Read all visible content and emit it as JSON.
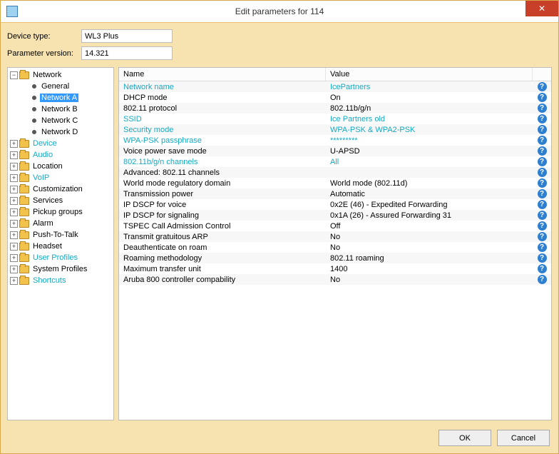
{
  "window": {
    "title": "Edit parameters for 114",
    "close_x": "✕"
  },
  "meta": {
    "device_type_label": "Device type:",
    "device_type_value": "WL3 Plus",
    "param_version_label": "Parameter version:",
    "param_version_value": "14.321"
  },
  "tree": {
    "root": {
      "label": "Network"
    },
    "children": [
      {
        "label": "General"
      },
      {
        "label": "Network A",
        "selected": true
      },
      {
        "label": "Network B"
      },
      {
        "label": "Network C"
      },
      {
        "label": "Network D"
      }
    ],
    "siblings": [
      {
        "label": "Device",
        "link": true
      },
      {
        "label": "Audio",
        "link": true
      },
      {
        "label": "Location"
      },
      {
        "label": "VoIP",
        "link": true
      },
      {
        "label": "Customization"
      },
      {
        "label": "Services"
      },
      {
        "label": "Pickup groups"
      },
      {
        "label": "Alarm"
      },
      {
        "label": "Push-To-Talk"
      },
      {
        "label": "Headset"
      },
      {
        "label": "User Profiles",
        "link": true
      },
      {
        "label": "System Profiles"
      },
      {
        "label": "Shortcuts",
        "link": true
      }
    ]
  },
  "grid": {
    "header_name": "Name",
    "header_value": "Value",
    "rows": [
      {
        "name": "Network name",
        "value": "IcePartners",
        "editable": true
      },
      {
        "name": "DHCP mode",
        "value": "On"
      },
      {
        "name": "802.11 protocol",
        "value": "802.11b/g/n"
      },
      {
        "name": "SSID",
        "value": "Ice Partners old",
        "editable": true
      },
      {
        "name": "Security mode",
        "value": "WPA-PSK & WPA2-PSK",
        "editable": true
      },
      {
        "name": "WPA-PSK passphrase",
        "value": "*********",
        "editable": true
      },
      {
        "name": "Voice power save mode",
        "value": "U-APSD"
      },
      {
        "name": "802.11b/g/n channels",
        "value": "All",
        "editable": true
      },
      {
        "name": "Advanced: 802.11 channels",
        "value": ""
      },
      {
        "name": "World mode regulatory domain",
        "value": "World mode (802.11d)"
      },
      {
        "name": "Transmission power",
        "value": "Automatic"
      },
      {
        "name": "IP DSCP for voice",
        "value": "0x2E (46) - Expedited Forwarding"
      },
      {
        "name": "IP DSCP for signaling",
        "value": "0x1A (26) - Assured Forwarding 31"
      },
      {
        "name": "TSPEC Call Admission Control",
        "value": "Off"
      },
      {
        "name": "Transmit gratuitous ARP",
        "value": "No"
      },
      {
        "name": "Deauthenticate on roam",
        "value": "No"
      },
      {
        "name": "Roaming methodology",
        "value": "802.11 roaming"
      },
      {
        "name": "Maximum transfer unit",
        "value": "1400"
      },
      {
        "name": "Aruba 800 controller compability",
        "value": "No"
      }
    ]
  },
  "buttons": {
    "ok": "OK",
    "cancel": "Cancel"
  }
}
